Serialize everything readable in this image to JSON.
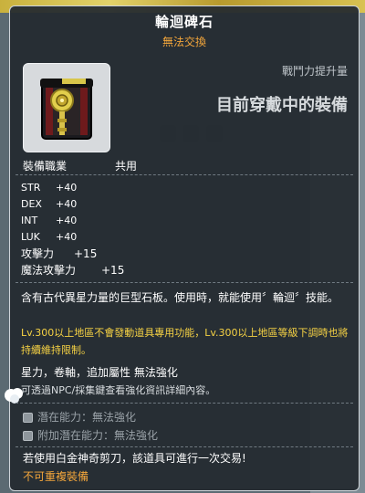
{
  "item": {
    "name": "輪迴碑石",
    "trade_status": "無法交換",
    "power_label": "戰鬥力提升量",
    "equipped_label": "目前穿戴中的裝備",
    "job_label": "裝備職業",
    "job_value": "共用"
  },
  "stats": [
    {
      "key": "STR",
      "value": "+40"
    },
    {
      "key": "DEX",
      "value": "+40"
    },
    {
      "key": "INT",
      "value": "+40"
    },
    {
      "key": "LUK",
      "value": "+40"
    },
    {
      "key": "攻擊力",
      "value": "+15"
    },
    {
      "key": "魔法攻擊力",
      "value": "+15"
    }
  ],
  "description": "含有古代異星力量的巨型石板。使用時，就能使用〞輪迴〞技能。",
  "warning": "Lv.300以上地區不會發動道具專用功能，Lv.300以上地區等級下調時也將持續維持限制。",
  "notes": {
    "enhance": "星力，卷軸，追加屬性 無法強化",
    "npc_hint": "可透過NPC/採集鍵查看強化資訊詳細內容。"
  },
  "potential": [
    {
      "label": "潛在能力：無法強化"
    },
    {
      "label": "附加潛在能力：無法強化"
    }
  ],
  "trade_info": "若使用白金神奇剪刀，該道具可進行一次交易!",
  "no_reequip": "不可重複裝備",
  "colors": {
    "accent": "#f3a63b",
    "warning": "#f6d244",
    "panel": "#242a30"
  }
}
